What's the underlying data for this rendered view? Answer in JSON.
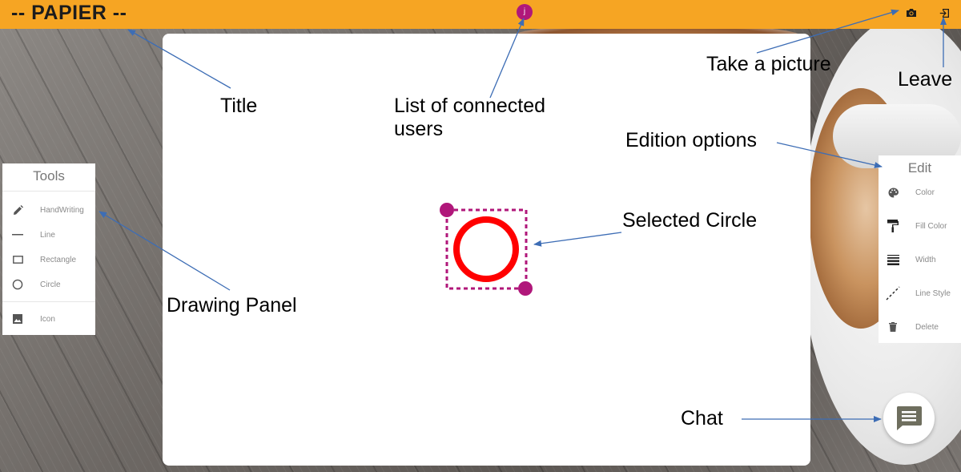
{
  "app": {
    "title": "-- PAPIER --",
    "accent_color": "#f6a523",
    "connected_users": [
      {
        "initial": "j",
        "color": "#b0177a"
      }
    ],
    "header_icons": [
      "camera-icon",
      "leave-icon"
    ]
  },
  "tools_panel": {
    "title": "Tools",
    "items": [
      {
        "label": "HandWriting",
        "icon": "pencil-icon"
      },
      {
        "label": "Line",
        "icon": "line-icon"
      },
      {
        "label": "Rectangle",
        "icon": "rectangle-icon"
      },
      {
        "label": "Circle",
        "icon": "circle-icon"
      },
      {
        "label": "Icon",
        "icon": "image-icon"
      }
    ]
  },
  "edit_panel": {
    "title": "Edit",
    "items": [
      {
        "label": "Color",
        "icon": "palette-icon"
      },
      {
        "label": "Fill Color",
        "icon": "paint-roller-icon"
      },
      {
        "label": "Width",
        "icon": "line-weight-icon"
      },
      {
        "label": "Line Style",
        "icon": "dashed-line-icon"
      },
      {
        "label": "Delete",
        "icon": "trash-icon"
      }
    ]
  },
  "canvas": {
    "selected_shape": {
      "type": "circle",
      "stroke_color": "#ff0000",
      "selection_color": "#b0177a"
    }
  },
  "chat": {
    "icon": "chat-icon"
  },
  "annotations": {
    "title": "Title",
    "users_line1": "List of connected",
    "users_line2": "users",
    "take_picture": "Take a picture",
    "leave": "Leave",
    "edition_options": "Edition options",
    "selected_circle": "Selected Circle",
    "drawing_panel": "Drawing Panel",
    "chat": "Chat",
    "arrow_color": "#3d6db5"
  }
}
